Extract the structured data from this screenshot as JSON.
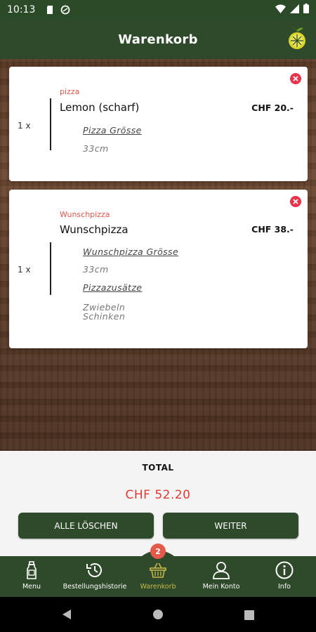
{
  "status_bar": {
    "time": "10:13"
  },
  "app_bar": {
    "title": "Warenkorb",
    "logo_icon": "lemon-logo-icon"
  },
  "cart": {
    "items": [
      {
        "quantity": "1 x",
        "category": "pizza",
        "name": "Lemon (scharf)",
        "price": "CHF 20.-",
        "options": [
          {
            "label": "Pizza Grösse",
            "value": "33cm"
          }
        ]
      },
      {
        "quantity": "1 x",
        "category": "Wunschpizza",
        "name": "Wunschpizza",
        "price": "CHF 38.-",
        "options": [
          {
            "label": "Wunschpizza Grösse",
            "value": "33cm"
          },
          {
            "label": "Pizzazusätze",
            "value": "Zwiebeln\nSchinken"
          }
        ]
      }
    ]
  },
  "summary": {
    "total_label": "TOTAL",
    "total_value": "CHF 52.20",
    "clear_button": "ALLE LÖSCHEN",
    "next_button": "WEITER"
  },
  "bottom_nav": {
    "badge_count": "2",
    "items": [
      {
        "label": "Menu",
        "icon": "menu-bottle-icon"
      },
      {
        "label": "Bestellungshistorie",
        "icon": "history-icon"
      },
      {
        "label": "Warenkorb",
        "icon": "basket-icon",
        "active": true
      },
      {
        "label": "Mein Konto",
        "icon": "account-icon"
      },
      {
        "label": "Info",
        "icon": "info-icon"
      }
    ]
  },
  "colors": {
    "primary": "#2f4a2b",
    "accent_red": "#e03a32",
    "remove_red": "#e8344a",
    "active_nav": "#c8b84a"
  }
}
